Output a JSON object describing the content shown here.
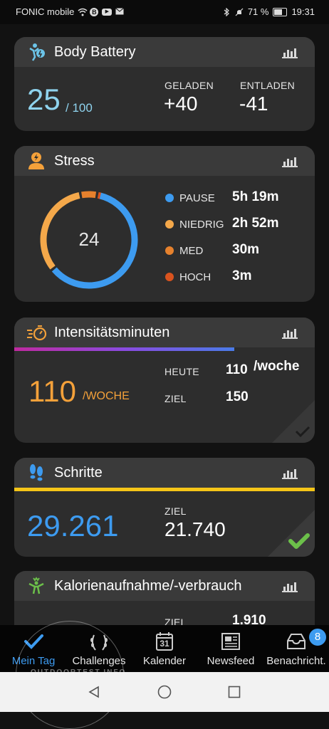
{
  "statusbar": {
    "carrier": "FONIC mobile",
    "battery": "71 %",
    "time": "19:31"
  },
  "body_battery": {
    "title": "Body Battery",
    "value": "25",
    "max": "/ 100",
    "charged_label": "GELADEN",
    "charged_value": "+40",
    "drained_label": "ENTLADEN",
    "drained_value": "-41"
  },
  "stress": {
    "title": "Stress",
    "score": "24",
    "items": [
      {
        "label": "PAUSE",
        "value": "5h 19m",
        "color": "#3d9bf0",
        "minutes": 319
      },
      {
        "label": "NIEDRIG",
        "value": "2h 52m",
        "color": "#f4a84a",
        "minutes": 172
      },
      {
        "label": "MED",
        "value": "30m",
        "color": "#e6812d",
        "minutes": 30
      },
      {
        "label": "HOCH",
        "value": "3m",
        "color": "#d9531e",
        "minutes": 3
      }
    ]
  },
  "intensity": {
    "title": "Intensitätsminuten",
    "value": "110",
    "unit": "/WOCHE",
    "today_label": "HEUTE",
    "today_value": "110",
    "today_unit": "/woche",
    "goal_label": "ZIEL",
    "goal_value": "150",
    "progress": 0.733,
    "value_color": "#f4a13a"
  },
  "steps": {
    "title": "Schritte",
    "value": "29.261",
    "goal_label": "ZIEL",
    "goal_value": "21.740",
    "progress": 1.0,
    "value_color": "#3d9bf0",
    "bar_color": "#f5c518",
    "check_color": "#6cc04a"
  },
  "calories": {
    "title": "Kalorienaufnahme/-verbrauch",
    "goal_label": "ZIEL",
    "goal_value": "1.910"
  },
  "nav": {
    "items": [
      {
        "label": "Mein Tag",
        "icon": "check-icon"
      },
      {
        "label": "Challenges",
        "icon": "laurel-icon"
      },
      {
        "label": "Kalender",
        "icon": "calendar-icon",
        "day": "31"
      },
      {
        "label": "Newsfeed",
        "icon": "newspaper-icon"
      },
      {
        "label": "Benachricht.",
        "icon": "inbox-icon",
        "badge": "8"
      }
    ]
  },
  "watermark": {
    "text": "OUTDOORTEST.INFO"
  }
}
